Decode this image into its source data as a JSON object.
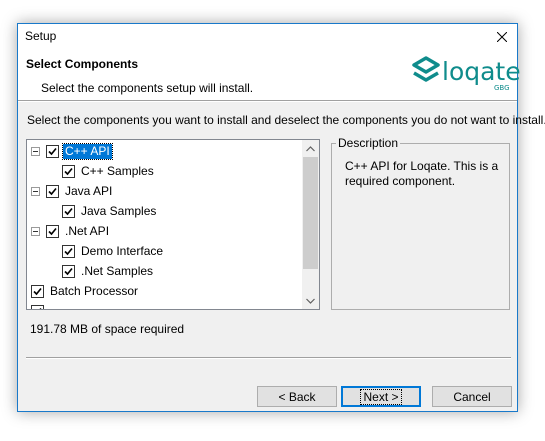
{
  "window": {
    "title": "Setup"
  },
  "header": {
    "title": "Select Components",
    "subtitle": "Select the components setup will install.",
    "logo_text": "loqate",
    "logo_sub": "GBG",
    "logo_color": "#0f8c8c"
  },
  "instructions": "Select the components you want to install and deselect the components you do not want to install.",
  "tree": {
    "items": [
      {
        "label": "C++ API",
        "level": 0,
        "expander": true,
        "checked": true,
        "selected": true
      },
      {
        "label": "C++ Samples",
        "level": 1,
        "expander": false,
        "checked": true,
        "selected": false
      },
      {
        "label": "Java API",
        "level": 0,
        "expander": true,
        "checked": true,
        "selected": false
      },
      {
        "label": "Java Samples",
        "level": 1,
        "expander": false,
        "checked": true,
        "selected": false
      },
      {
        "label": ".Net API",
        "level": 0,
        "expander": true,
        "checked": true,
        "selected": false
      },
      {
        "label": "Demo Interface",
        "level": 1,
        "expander": false,
        "checked": true,
        "selected": false
      },
      {
        "label": ".Net Samples",
        "level": 1,
        "expander": false,
        "checked": true,
        "selected": false
      },
      {
        "label": "Batch Processor",
        "level": 0,
        "expander": false,
        "checked": true,
        "selected": false
      }
    ]
  },
  "description": {
    "legend": "Description",
    "text": "C++ API for Loqate.  This is a required component."
  },
  "space_required": "191.78 MB of space required",
  "buttons": {
    "back": "< Back",
    "next": "Next >",
    "cancel": "Cancel"
  },
  "colors": {
    "selection": "#0078d7",
    "window_border": "#1979ca"
  },
  "icons": {
    "close": "close-icon",
    "check": "check-icon",
    "scroll_up": "chevron-up-icon",
    "scroll_down": "chevron-down-icon",
    "logo": "loqate-logo"
  }
}
